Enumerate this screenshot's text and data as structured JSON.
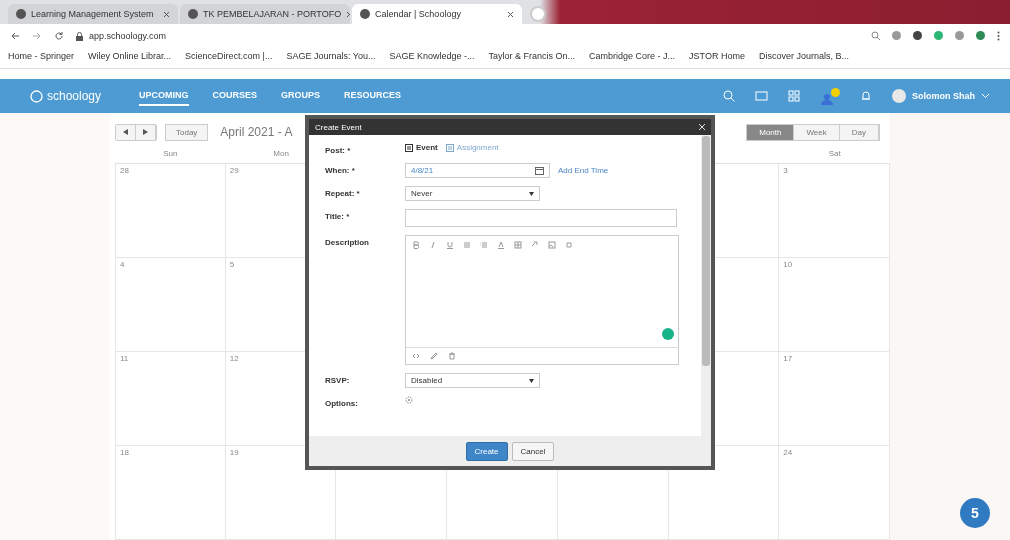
{
  "browser": {
    "tabs": [
      {
        "title": "Learning Management System",
        "selected": false
      },
      {
        "title": "TK PEMBELAJARAN - PORTOFO",
        "selected": false
      },
      {
        "title": "Calendar | Schoology",
        "selected": true
      }
    ],
    "url": "app.schoology.com",
    "bookmarks": [
      "Home - Springer",
      "Wiley Online Librar...",
      "ScienceDirect.com |...",
      "SAGE Journals: You...",
      "SAGE Knowledge -...",
      "Taylor & Francis On...",
      "Cambridge Core - J...",
      "JSTOR Home",
      "Discover Journals, B..."
    ]
  },
  "header": {
    "logo": "schoology",
    "nav": [
      {
        "label": "UPCOMING",
        "selected": true
      },
      {
        "label": "COURSES",
        "selected": false
      },
      {
        "label": "GROUPS",
        "selected": false
      },
      {
        "label": "RESOURCES",
        "selected": false
      }
    ],
    "user": "Solomon Shah"
  },
  "calendar": {
    "today": "Today",
    "range": "April 2021 - A",
    "views": [
      {
        "label": "Month",
        "selected": true
      },
      {
        "label": "Week",
        "selected": false
      },
      {
        "label": "Day",
        "selected": false
      }
    ],
    "columns": [
      {
        "weekday": "Sun",
        "dates": [
          "28",
          "4",
          "11",
          "18"
        ]
      },
      {
        "weekday": "Mon",
        "dates": [
          "29",
          "5",
          "12",
          "19"
        ]
      },
      {},
      {},
      {},
      {},
      {
        "weekday": "Sat",
        "dates": [
          "3",
          "10",
          "17",
          "24"
        ]
      }
    ]
  },
  "dialog": {
    "title": "Create Event",
    "post": {
      "label": "Post: *",
      "options": [
        {
          "label": "Event",
          "selected": true
        },
        {
          "label": "Assignment",
          "selected": false
        }
      ]
    },
    "when": {
      "label": "When: *",
      "value": "4/8/21",
      "link": "Add End Time"
    },
    "repeat": {
      "label": "Repeat: *",
      "value": "Never"
    },
    "title_field": {
      "label": "Title: *"
    },
    "description": {
      "label": "Description"
    },
    "rsvp": {
      "label": "RSVP:",
      "value": "Disabled"
    },
    "options": {
      "label": "Options:"
    },
    "buttons": [
      {
        "label": "Create",
        "kind": "primary"
      },
      {
        "label": "Cancel",
        "kind": "secondary"
      }
    ]
  },
  "chat_badge": "5"
}
